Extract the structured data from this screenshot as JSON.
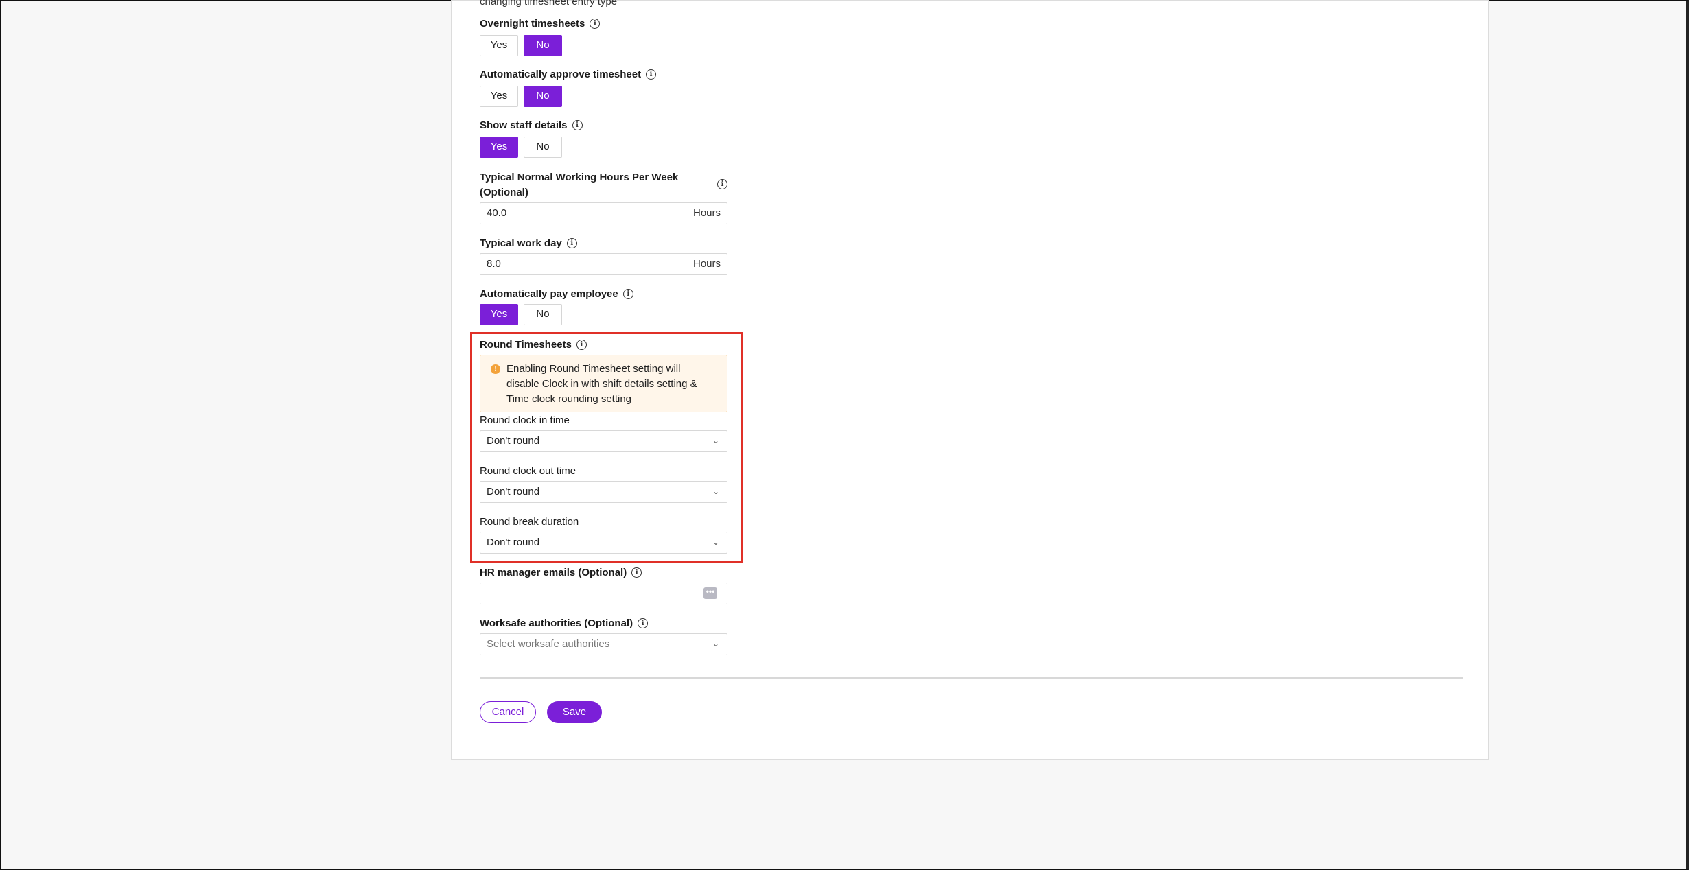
{
  "form": {
    "cut_off_text": "changing timesheet entry type",
    "overnight": {
      "label": "Overnight timesheets",
      "yes": "Yes",
      "no": "No",
      "selected": "No"
    },
    "auto_approve": {
      "label": "Automatically approve timesheet",
      "yes": "Yes",
      "no": "No",
      "selected": "No"
    },
    "show_staff": {
      "label": "Show staff details",
      "yes": "Yes",
      "no": "No",
      "selected": "Yes"
    },
    "weekly_hours": {
      "label_line1": "Typical Normal Working Hours Per Week",
      "label_line2": "(Optional)",
      "value": "40.0",
      "unit": "Hours"
    },
    "work_day": {
      "label": "Typical work day",
      "value": "8.0",
      "unit": "Hours"
    },
    "auto_pay": {
      "label": "Automatically pay employee",
      "yes": "Yes",
      "no": "No",
      "selected": "Yes"
    },
    "round_timesheets": {
      "label": "Round Timesheets",
      "warning_line1": "Enabling Round Timesheet setting will",
      "warning_line2": "disable Clock in with shift details setting &",
      "warning_line3": "Time clock rounding setting",
      "warning_icon": "!",
      "clock_in": {
        "label": "Round clock in time",
        "value": "Don't round"
      },
      "clock_out": {
        "label": "Round clock out time",
        "value": "Don't round"
      },
      "break_duration": {
        "label": "Round break duration",
        "value": "Don't round"
      }
    },
    "hr_emails": {
      "label": "HR manager emails (Optional)",
      "value": "",
      "button_glyph": "•••"
    },
    "worksafe": {
      "label": "Worksafe authorities (Optional)",
      "placeholder": "Select worksafe authorities"
    },
    "info_glyph": "i",
    "chevron_glyph": "⌄"
  },
  "actions": {
    "cancel": "Cancel",
    "save": "Save"
  },
  "colors": {
    "accent": "#7b1fd8",
    "warning_bg": "#fff6ea",
    "warning_border": "#f2b45f",
    "highlight": "#e03028"
  }
}
